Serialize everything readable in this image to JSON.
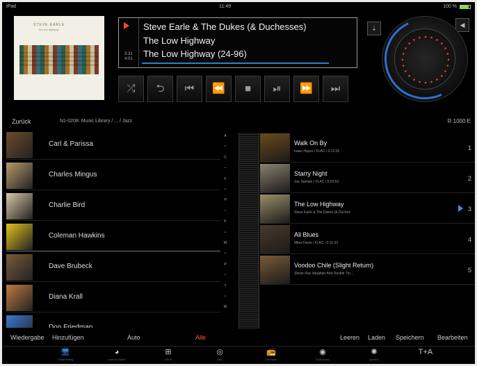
{
  "status_bar": {
    "left": "iPad",
    "time": "11:49",
    "battery": "100 %"
  },
  "now_playing": {
    "artist": "Steve Earle & The Dukes (& Duchesses)",
    "album": "The Low Highway",
    "track": "The Low Highway (24-96)",
    "elapsed": "3:31",
    "total": "4:01",
    "progress": 0.88
  },
  "album_art": {
    "title": "STEVE EARLE",
    "subtitle": "the low highway"
  },
  "transport": [
    {
      "name": "shuffle-icon",
      "glyph": "⤮"
    },
    {
      "name": "repeat-icon",
      "glyph": "⮌"
    },
    {
      "name": "previous-track-icon",
      "glyph": "⏮"
    },
    {
      "name": "rewind-icon",
      "glyph": "⏪"
    },
    {
      "name": "stop-icon",
      "glyph": "■"
    },
    {
      "name": "play-pause-icon",
      "glyph": "⏯"
    },
    {
      "name": "fast-forward-icon",
      "glyph": "⏩"
    },
    {
      "name": "next-track-icon",
      "glyph": "⏭"
    }
  ],
  "breadcrumb": {
    "back": "Zurück",
    "path": "N1-0208: Music Library / ... / Jazz",
    "device": "R 1000 E"
  },
  "artists": [
    {
      "name": "Carl & Parissa",
      "color": "#6b4a2a"
    },
    {
      "name": "Charles Mingus",
      "color": "#b79a6a"
    },
    {
      "name": "Charlie Bird",
      "color": "#d8c9a5"
    },
    {
      "name": "Coleman Hawkins",
      "color": "#e0c21a"
    },
    {
      "name": "Dave Brubeck",
      "color": "#7a5a3a"
    },
    {
      "name": "Diana Krall",
      "color": "#c07a40"
    },
    {
      "name": "Don Friedman",
      "color": "#3a7ad0"
    }
  ],
  "alpha_index": [
    "A",
    "•",
    "C",
    "•",
    "F",
    "•",
    "H",
    "•",
    "K",
    "•",
    "M",
    "•",
    "P",
    "•",
    "T",
    "•",
    "W"
  ],
  "playlist": [
    {
      "title": "Walk On By",
      "sub": "Isaac Hayes / FLAC / 0:12:02",
      "num": "1",
      "color": "#6a4a1a",
      "playing": false
    },
    {
      "title": "Starry Night",
      "sub": "Joe Satriani / FLAC / 0:03:53",
      "num": "2",
      "color": "#8a8070",
      "playing": false
    },
    {
      "title": "The Low Highway",
      "sub": "Steve Earle & The Dukes (& Duches",
      "num": "3",
      "color": "#9a8f6a",
      "playing": true
    },
    {
      "title": "All Blues",
      "sub": "Miles Davis / FLAC / 0:11:33",
      "num": "4",
      "color": "#4a3a2a",
      "playing": false
    },
    {
      "title": "Voodoo Chile (Slight Return)",
      "sub": "Stevie Ray Vaughan And Double Tro...",
      "num": "5",
      "color": "#7a5a3a",
      "playing": false
    }
  ],
  "actions": {
    "wiedergabe": "Wiedergabe",
    "hinzufuegen": "Hinzufügen",
    "auto": "Auto",
    "alle": "Alle",
    "leeren": "Leeren",
    "laden": "Laden",
    "speichern": "Speichern",
    "bearbeiten": "Bearbeiten"
  },
  "tabs": [
    {
      "label": "OnlyFunding",
      "icon": "🖥",
      "name": "tab-control",
      "active": true
    },
    {
      "label": "Internet Radio",
      "icon": "◕",
      "name": "tab-internet-radio",
      "active": false
    },
    {
      "label": "UPnP",
      "icon": "⊞",
      "name": "tab-upnp",
      "active": false
    },
    {
      "label": "Disc",
      "icon": "◎",
      "name": "tab-disc",
      "active": false
    },
    {
      "label": "FM Radio",
      "icon": "📻",
      "name": "tab-fm-radio",
      "active": false
    },
    {
      "label": "DAB Radio",
      "icon": "◉",
      "name": "tab-dab-radio",
      "active": false
    },
    {
      "label": "Quellen",
      "icon": "✺",
      "name": "tab-sources",
      "active": false
    },
    {
      "label": "",
      "icon": "T+A",
      "name": "tab-brand",
      "active": false
    }
  ],
  "colors": {
    "accent": "#2d7fd2",
    "play": "#ff4b1f",
    "alle": "#ff5a2c"
  }
}
